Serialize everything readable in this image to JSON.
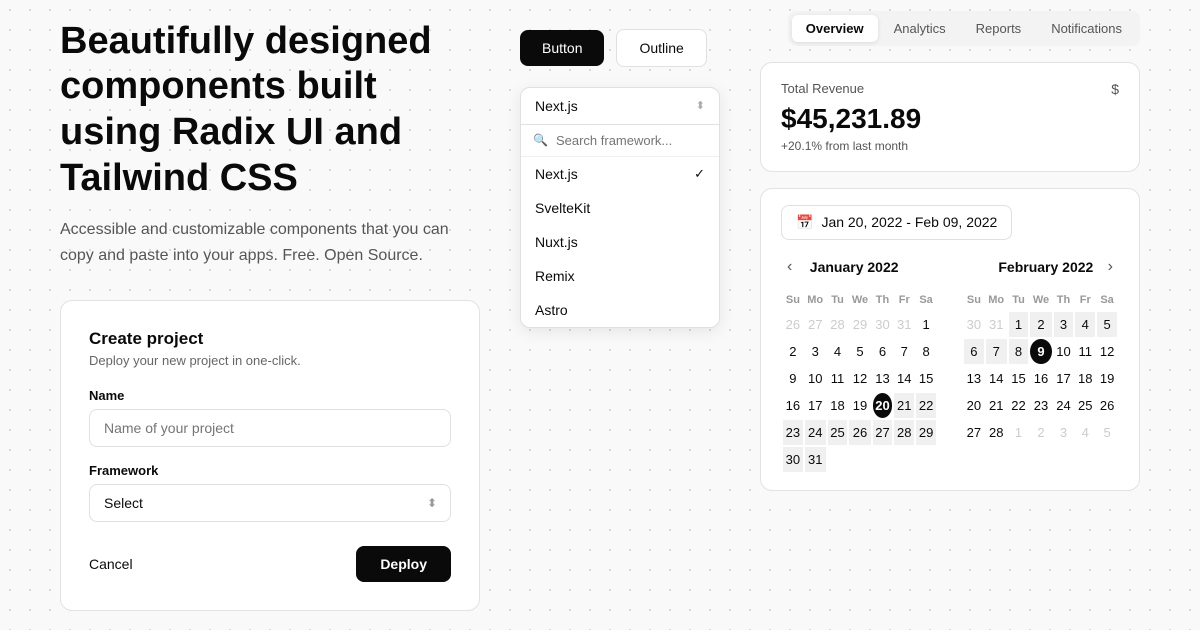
{
  "hero": {
    "title": "Beautifully designed components built using Radix UI and Tailwind CSS",
    "subtitle": "Accessible and customizable components that you can copy and paste into your apps. Free. Open Source."
  },
  "create_project": {
    "title": "Create project",
    "subtitle": "Deploy your new project in one-click.",
    "name_label": "Name",
    "name_placeholder": "Name of your project",
    "framework_label": "Framework",
    "framework_placeholder": "Select",
    "cancel_label": "Cancel",
    "deploy_label": "Deploy"
  },
  "buttons": {
    "solid_label": "Button",
    "outline_label": "Outline"
  },
  "framework_dropdown": {
    "trigger": "Next.js",
    "search_placeholder": "Search framework...",
    "options": [
      {
        "label": "Next.js",
        "selected": true
      },
      {
        "label": "SvelteKit",
        "selected": false
      },
      {
        "label": "Nuxt.js",
        "selected": false
      },
      {
        "label": "Remix",
        "selected": false
      },
      {
        "label": "Astro",
        "selected": false
      }
    ]
  },
  "revenue": {
    "label": "Total Revenue",
    "amount": "$45,231.89",
    "change": "+20.1% from last month"
  },
  "tabs": [
    {
      "label": "Overview",
      "active": true
    },
    {
      "label": "Analytics",
      "active": false
    },
    {
      "label": "Reports",
      "active": false
    },
    {
      "label": "Notifications",
      "active": false
    }
  ],
  "date_range": {
    "display": "Jan 20, 2022 - Feb 09, 2022"
  },
  "calendar": {
    "january": {
      "month": "January 2022",
      "days_header": [
        "Su",
        "Mo",
        "Tu",
        "We",
        "Th",
        "Fr",
        "Sa"
      ],
      "weeks": [
        [
          "26",
          "27",
          "28",
          "29",
          "30",
          "31",
          "1"
        ],
        [
          "2",
          "3",
          "4",
          "5",
          "6",
          "7",
          "8"
        ],
        [
          "9",
          "10",
          "11",
          "12",
          "13",
          "14",
          "15"
        ],
        [
          "16",
          "17",
          "18",
          "19",
          "20",
          "21",
          "22"
        ],
        [
          "23",
          "24",
          "25",
          "26",
          "27",
          "28",
          "29"
        ],
        [
          "30",
          "31",
          "",
          "",
          "",
          "",
          ""
        ]
      ],
      "other_month_first": [
        "26",
        "27",
        "28",
        "29",
        "30",
        "31"
      ],
      "selected_start": "20"
    },
    "february": {
      "month": "February 2022",
      "days_header": [
        "Su",
        "Mo",
        "Tu",
        "We",
        "Th",
        "Fr",
        "Sa"
      ],
      "weeks": [
        [
          "30",
          "31",
          "1",
          "2",
          "3",
          "4",
          "5"
        ],
        [
          "6",
          "7",
          "8",
          "9",
          "10",
          "11",
          "12"
        ],
        [
          "13",
          "14",
          "15",
          "16",
          "17",
          "18",
          "19"
        ],
        [
          "20",
          "21",
          "22",
          "23",
          "24",
          "25",
          "26"
        ],
        [
          "27",
          "28",
          "1",
          "2",
          "3",
          "4",
          "5"
        ],
        [
          "",
          "",
          "",
          "",
          "",
          "",
          ""
        ]
      ],
      "other_month_last": [
        "30",
        "31"
      ],
      "selected_end": "9"
    }
  }
}
